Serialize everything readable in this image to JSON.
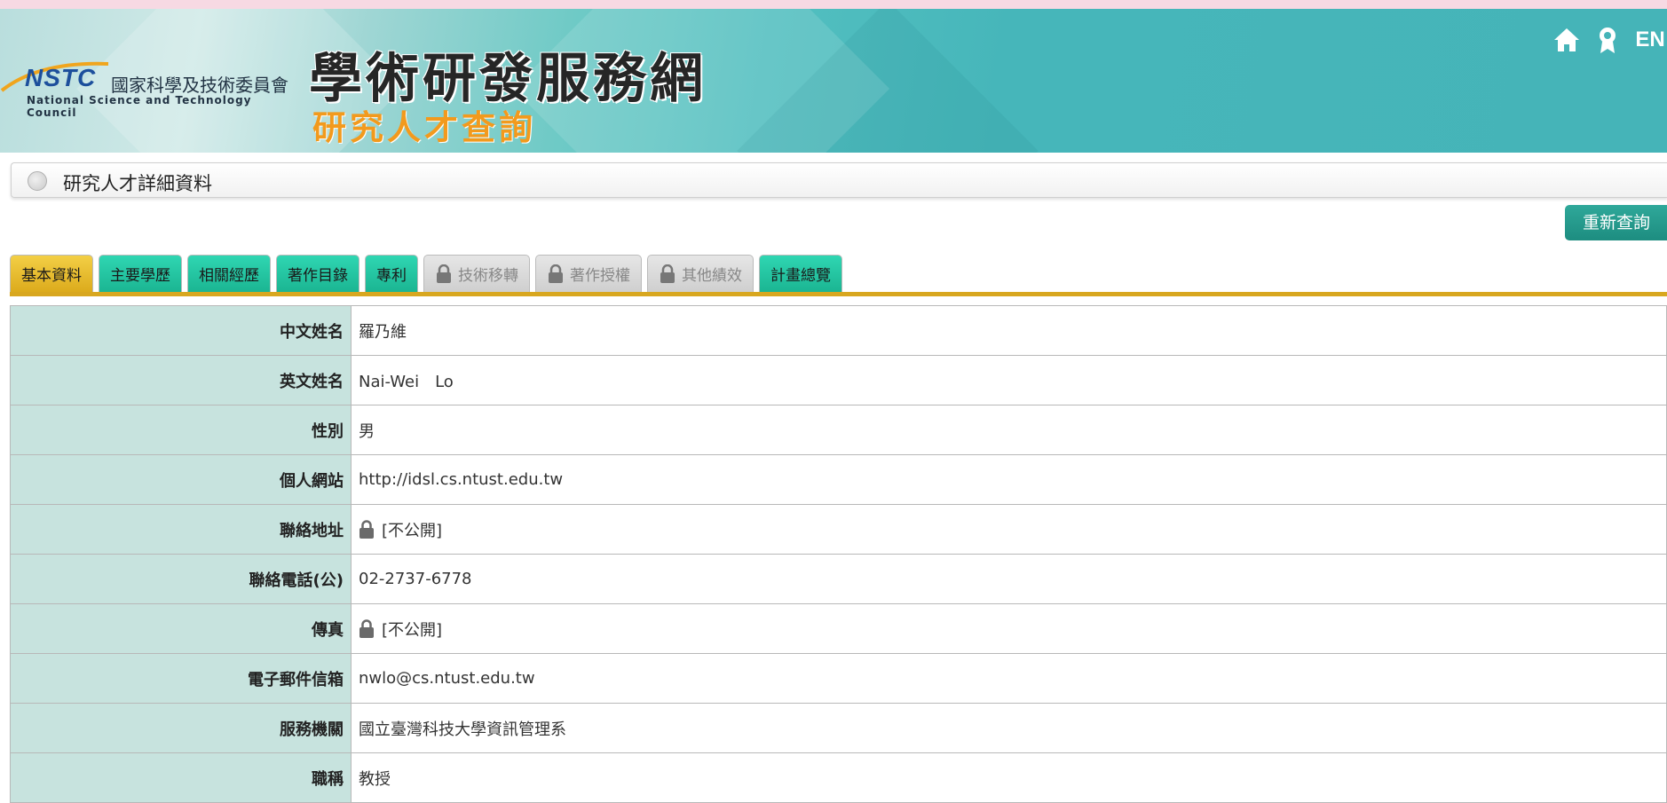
{
  "banner": {
    "logo_abbr": "NSTC",
    "logo_cn": "國家科學及技術委員會",
    "logo_en": "National Science and Technology Council",
    "title": "學術研發服務網",
    "subtitle": "研究人才查詢",
    "lang_label": "EN"
  },
  "header": {
    "title": "研究人才詳細資料"
  },
  "requery_label": "重新查詢",
  "tabs": [
    {
      "label": "基本資料",
      "state": "active"
    },
    {
      "label": "主要學歷",
      "state": "normal"
    },
    {
      "label": "相關經歷",
      "state": "normal"
    },
    {
      "label": "著作目錄",
      "state": "normal"
    },
    {
      "label": "專利",
      "state": "normal"
    },
    {
      "label": "技術移轉",
      "state": "locked"
    },
    {
      "label": "著作授權",
      "state": "locked"
    },
    {
      "label": "其他績效",
      "state": "locked"
    },
    {
      "label": "計畫總覽",
      "state": "normal"
    }
  ],
  "info_rows": [
    {
      "label": "中文姓名",
      "value": "羅乃維"
    },
    {
      "label": "英文姓名",
      "value": "Nai-Wei　Lo"
    },
    {
      "label": "性別",
      "value": "男"
    },
    {
      "label": "個人網站",
      "value": "http://idsl.cs.ntust.edu.tw"
    },
    {
      "label": "聯絡地址",
      "value": "[不公開]",
      "locked": true
    },
    {
      "label": "聯絡電話(公)",
      "value": "02-2737-6778"
    },
    {
      "label": "傳真",
      "value": "[不公開]",
      "locked": true
    },
    {
      "label": "電子郵件信箱",
      "value": "nwlo@cs.ntust.edu.tw"
    },
    {
      "label": "服務機關",
      "value": "國立臺灣科技大學資訊管理系"
    },
    {
      "label": "職稱",
      "value": "教授"
    }
  ],
  "colors": {
    "tab_active": "#dcab1c",
    "tab_normal": "#1bb592",
    "tab_locked": "#cfcfcf",
    "label_bg": "#c7e3de",
    "banner_teal": "#45b4b8"
  }
}
